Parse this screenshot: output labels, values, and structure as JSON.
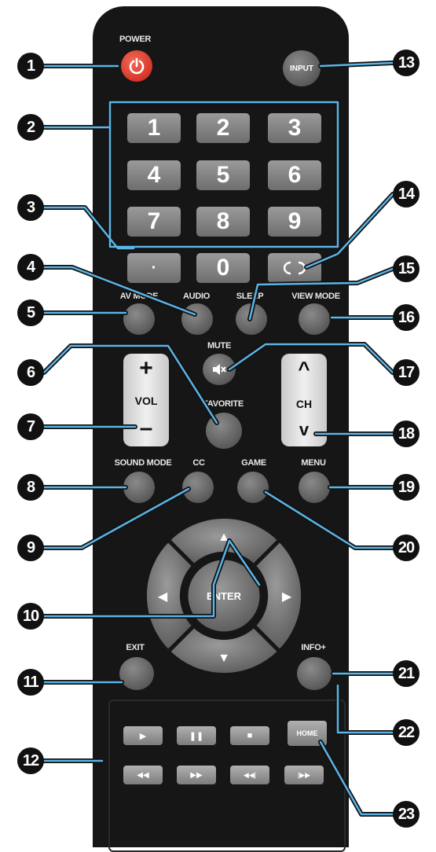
{
  "remote": {
    "top": {
      "power_label": "POWER",
      "power_icon": "power-icon",
      "input_label": "INPUT"
    },
    "numbers": [
      "1",
      "2",
      "3",
      "4",
      "5",
      "6",
      "7",
      "8",
      "9",
      "0"
    ],
    "dot_label": "·",
    "recall_icon": "recall-arrows-icon",
    "row_labels": {
      "av_mode": "AV MODE",
      "audio": "AUDIO",
      "sleep": "SLEEP",
      "view_mode": "VIEW MODE"
    },
    "mute_label": "MUTE",
    "mute_icon": "speaker-mute-icon",
    "favorite_label": "FAVORITE",
    "vol": {
      "plus": "+",
      "label": "VOL",
      "minus": "–"
    },
    "ch": {
      "up": "^",
      "label": "CH",
      "down": "v"
    },
    "bottom_labels": {
      "sound_mode": "SOUND MODE",
      "cc": "CC",
      "game": "GAME",
      "menu": "MENU"
    },
    "nav": {
      "enter_label": "ENTER",
      "up": "▲",
      "down": "▼",
      "left": "◀",
      "right": "▶"
    },
    "exit_label": "EXIT",
    "info_label": "INFO+",
    "home_label": "HOME",
    "playback": [
      "▶",
      "❚❚",
      "■",
      "◀◀",
      "▶▶",
      "◀◀|",
      "|▶▶"
    ],
    "playback_icons": [
      "play-icon",
      "pause-icon",
      "stop-icon",
      "rewind-icon",
      "fast-forward-icon",
      "previous-icon",
      "next-icon"
    ]
  },
  "callouts": [
    "1",
    "2",
    "3",
    "4",
    "5",
    "6",
    "7",
    "8",
    "9",
    "10",
    "11",
    "12",
    "13",
    "14",
    "15",
    "16",
    "17",
    "18",
    "19",
    "20",
    "21",
    "22",
    "23"
  ],
  "colors": {
    "body": "#161616",
    "power": "#d83a2c",
    "callout_line": "#5ab4e6",
    "callout_fill": "#111111"
  }
}
